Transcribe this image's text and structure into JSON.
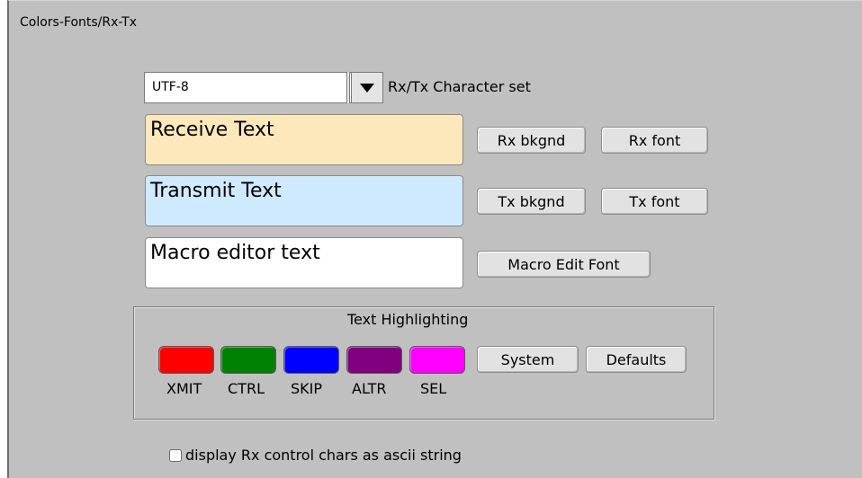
{
  "panel": {
    "title": "Colors-Fonts/Rx-Tx"
  },
  "charset": {
    "value": "UTF-8",
    "label": "Rx/Tx Character set",
    "dropdown_icon": "triangle-down-icon"
  },
  "previews": {
    "rx_text": "Receive Text",
    "tx_text": "Transmit Text",
    "macro_text": "Macro editor text",
    "rx_bg_color": "#fce8ba",
    "tx_bg_color": "#cfeafe",
    "macro_bg_color": "#ffffff"
  },
  "buttons": {
    "rx_bkgnd": "Rx bkgnd",
    "rx_font": "Rx font",
    "tx_bkgnd": "Tx bkgnd",
    "tx_font": "Tx font",
    "macro_edit_font": "Macro Edit Font"
  },
  "highlighting": {
    "title": "Text Highlighting",
    "swatches": [
      {
        "label": "XMIT",
        "color": "#ff0000"
      },
      {
        "label": "CTRL",
        "color": "#008000"
      },
      {
        "label": "SKIP",
        "color": "#0000ff"
      },
      {
        "label": "ALTR",
        "color": "#800080"
      },
      {
        "label": "SEL",
        "color": "#ff00ff"
      }
    ],
    "system_label": "System",
    "defaults_label": "Defaults"
  },
  "options": {
    "rx_ctrl_ascii_label": "display Rx control chars as ascii string",
    "rx_ctrl_ascii_checked": false
  }
}
